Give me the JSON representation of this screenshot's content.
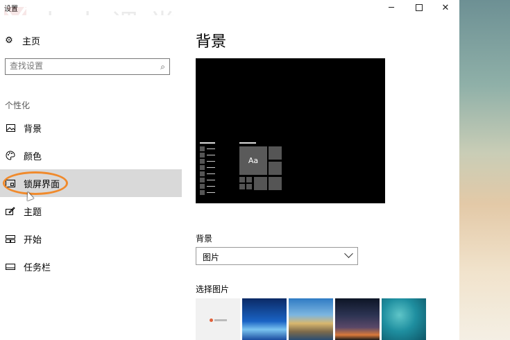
{
  "window": {
    "title": "设置"
  },
  "watermark": {
    "text": "小小课堂"
  },
  "sidebar": {
    "home_label": "主页",
    "search_placeholder": "查找设置",
    "section_title": "个性化",
    "items": [
      {
        "label": "背景",
        "icon": "image-icon"
      },
      {
        "label": "颜色",
        "icon": "palette-icon"
      },
      {
        "label": "锁屏界面",
        "icon": "lock-screen-icon",
        "active": true
      },
      {
        "label": "主题",
        "icon": "theme-icon"
      },
      {
        "label": "开始",
        "icon": "start-icon"
      },
      {
        "label": "任务栏",
        "icon": "taskbar-icon"
      }
    ]
  },
  "main": {
    "title": "背景",
    "preview": {
      "tile_text": "Aa"
    },
    "background_label": "背景",
    "background_value": "图片",
    "choose_picture_label": "选择图片"
  }
}
